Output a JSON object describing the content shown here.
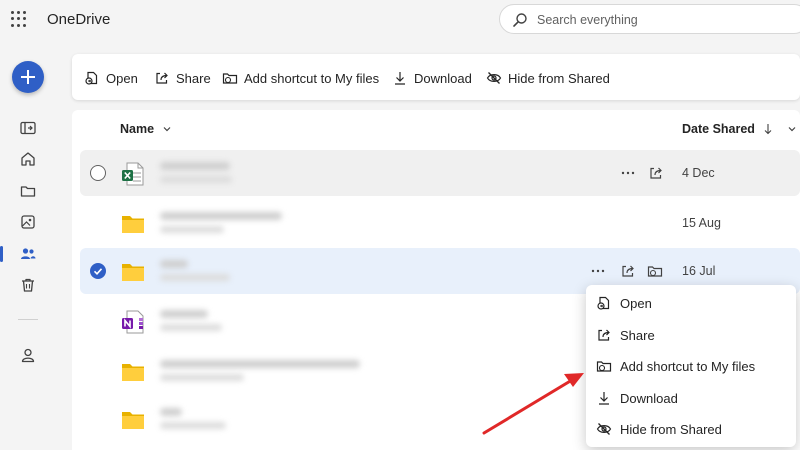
{
  "app": {
    "name": "OneDrive"
  },
  "search": {
    "placeholder": "Search everything"
  },
  "toolbar": {
    "open": "Open",
    "share": "Share",
    "add_shortcut": "Add shortcut to My files",
    "download": "Download",
    "hide": "Hide from Shared"
  },
  "list": {
    "name_header": "Name",
    "date_header": "Date Shared",
    "rows": [
      {
        "type": "excel",
        "date": "4 Dec"
      },
      {
        "type": "folder",
        "date": "15 Aug"
      },
      {
        "type": "folder",
        "date": "16 Jul"
      },
      {
        "type": "onenote",
        "date": ""
      },
      {
        "type": "folder",
        "date": ""
      },
      {
        "type": "folder",
        "date": ""
      }
    ]
  },
  "context_menu": {
    "open": "Open",
    "share": "Share",
    "add_shortcut": "Add shortcut to My files",
    "download": "Download",
    "hide": "Hide from Shared"
  },
  "colors": {
    "accent": "#2f5fc6",
    "annotation_arrow": "#e02828"
  }
}
